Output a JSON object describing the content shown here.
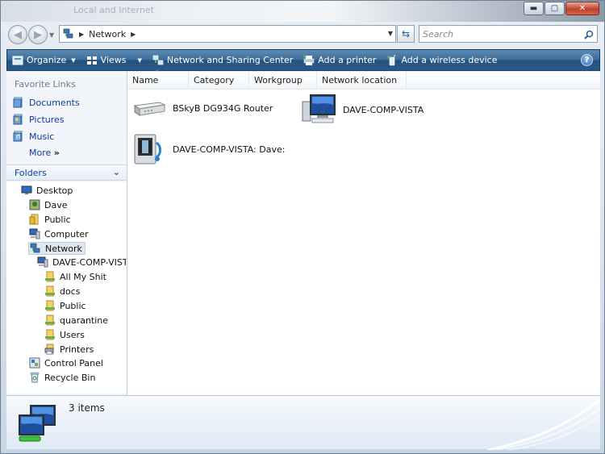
{
  "window": {
    "title_ghost": "Local and Internet"
  },
  "caption_buttons": {
    "minimize": "▬",
    "maximize": "▢",
    "close": "✕"
  },
  "address": {
    "crumb": "Network"
  },
  "search": {
    "placeholder": "Search"
  },
  "commandbar": {
    "items": [
      {
        "label": "Organize",
        "icon": "organize-icon",
        "dropdown": true
      },
      {
        "label": "Views",
        "icon": "views-icon",
        "dropdown": true
      },
      {
        "label": "Network and Sharing Center",
        "icon": "network-sharing-icon",
        "dropdown": false
      },
      {
        "label": "Add a printer",
        "icon": "printer-icon",
        "dropdown": false
      },
      {
        "label": "Add a wireless device",
        "icon": "wireless-device-icon",
        "dropdown": false
      }
    ],
    "help": "?"
  },
  "navpane": {
    "favorites_title": "Favorite Links",
    "favorites": [
      "Documents",
      "Pictures",
      "Music"
    ],
    "more": "More",
    "folders_title": "Folders",
    "tree": [
      {
        "label": "Desktop",
        "icon": "desktop-icon"
      },
      {
        "label": "Dave",
        "icon": "user-folder-icon"
      },
      {
        "label": "Public",
        "icon": "folder-icon"
      },
      {
        "label": "Computer",
        "icon": "computer-icon"
      },
      {
        "label": "Network",
        "icon": "network-icon",
        "selected": true
      },
      {
        "label": "DAVE-COMP-VISTA",
        "icon": "computer-icon"
      },
      {
        "label": "All My Shit",
        "icon": "share-folder-icon"
      },
      {
        "label": "docs",
        "icon": "share-folder-icon"
      },
      {
        "label": "Public",
        "icon": "share-folder-icon"
      },
      {
        "label": "quarantine",
        "icon": "share-folder-icon"
      },
      {
        "label": "Users",
        "icon": "share-folder-icon"
      },
      {
        "label": "Printers",
        "icon": "printer-folder-icon"
      },
      {
        "label": "Control Panel",
        "icon": "control-panel-icon"
      },
      {
        "label": "Recycle Bin",
        "icon": "recycle-bin-icon"
      }
    ]
  },
  "columns": [
    "Name",
    "Category",
    "Workgroup",
    "Network location"
  ],
  "items": [
    {
      "label": "BSkyB DG934G Router",
      "icon": "router-icon"
    },
    {
      "label": "DAVE-COMP-VISTA",
      "icon": "computer-icon"
    },
    {
      "label": "DAVE-COMP-VISTA: Dave:",
      "icon": "media-device-icon"
    }
  ],
  "details": {
    "count": "3 items"
  }
}
